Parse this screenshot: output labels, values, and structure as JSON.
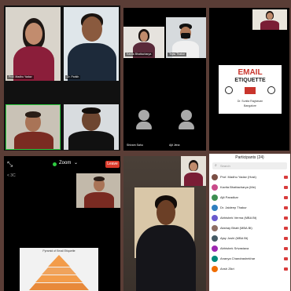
{
  "colors": {
    "accent_green": "#2ecc40",
    "leave_red": "#d93a2b",
    "email_red": "#c9352c"
  },
  "panel1": {
    "names": [
      "Prof. Madhu Yadav",
      "Dr. Parikh",
      "",
      ""
    ]
  },
  "panel2": {
    "names": [
      "Kavita Bhattacharya",
      "Tejas Thakur",
      "Shivam Sahu",
      "Ajit Jena"
    ]
  },
  "panel3": {
    "top_label": "",
    "slide_title_1": "EMAIL",
    "slide_title_2": "ETIQUETTE",
    "slide_caption_1": "Dr. Sunita Raghavan",
    "slide_caption_2": "Bangalore"
  },
  "panel4": {
    "zoom_label": "Zoom",
    "leave_label": "Leave",
    "back_label": "< 3C",
    "slide_header": "Pyramid of Email Etiquette"
  },
  "panel6": {
    "header": "Participants (24)",
    "search_placeholder": "Search",
    "participants": [
      {
        "name": "Prof. Madhu Yadav (Host)",
        "color": "#7b4f45"
      },
      {
        "name": "Kavita Bhattacharya (Me)",
        "color": "#c94b8a"
      },
      {
        "name": "Ajit Paradkar",
        "color": "#3e8e52"
      },
      {
        "name": "Dr. Jaideep Thakur",
        "color": "#2f7fbf"
      },
      {
        "name": "Abhishek Verma (MBA Bt)",
        "color": "#6a5acd"
      },
      {
        "name": "Akshay Bhatt (MBA Bt)",
        "color": "#8d6e63"
      },
      {
        "name": "Ajay Joshi (MBA Bt)",
        "color": "#455a64"
      },
      {
        "name": "Abhishek Srivastava",
        "color": "#9c27b0"
      },
      {
        "name": "Ananya Chandrashekhar",
        "color": "#00897b"
      },
      {
        "name": "Ansh Zikri",
        "color": "#ef6c00"
      }
    ]
  }
}
